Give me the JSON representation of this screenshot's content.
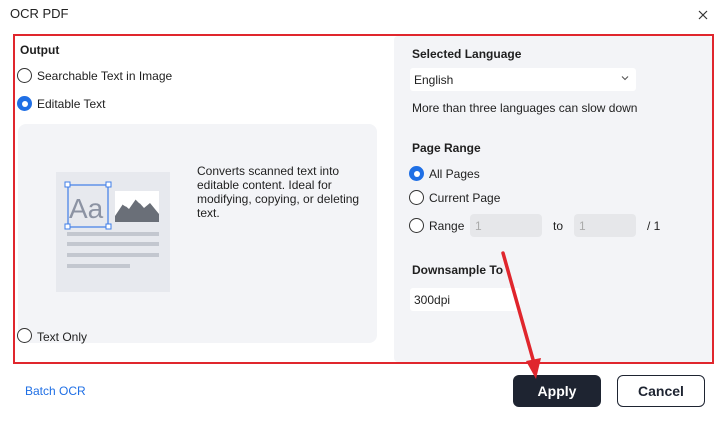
{
  "window": {
    "title": "OCR PDF"
  },
  "output": {
    "title": "Output",
    "options": [
      {
        "label": "Searchable Text in Image",
        "checked": false
      },
      {
        "label": "Editable Text",
        "checked": true
      },
      {
        "label": "Text Only",
        "checked": false
      }
    ],
    "preview": {
      "sample_text": "Aa",
      "description": "Converts scanned text into editable content. Ideal for modifying, copying, or deleting text."
    }
  },
  "language": {
    "title": "Selected Language",
    "selected": "English",
    "note": "More than three languages can slow down"
  },
  "page_range": {
    "title": "Page Range",
    "options": [
      {
        "label": "All Pages",
        "checked": true
      },
      {
        "label": "Current Page",
        "checked": false
      },
      {
        "label": "Range",
        "checked": false
      }
    ],
    "range_from": "1",
    "range_to_label": "to",
    "range_to": "1",
    "total": "/ 1"
  },
  "downsample": {
    "title": "Downsample To",
    "value": "300dpi"
  },
  "footer": {
    "batch_label": "Batch OCR",
    "apply_label": "Apply",
    "cancel_label": "Cancel"
  },
  "colors": {
    "accent": "#1f6fe5",
    "highlight": "#e0262d",
    "primary_button": "#1e2431",
    "panel": "#f3f4f7"
  },
  "icons": [
    "close-icon",
    "chevron-down-icon",
    "image-thumbnail-icon"
  ]
}
